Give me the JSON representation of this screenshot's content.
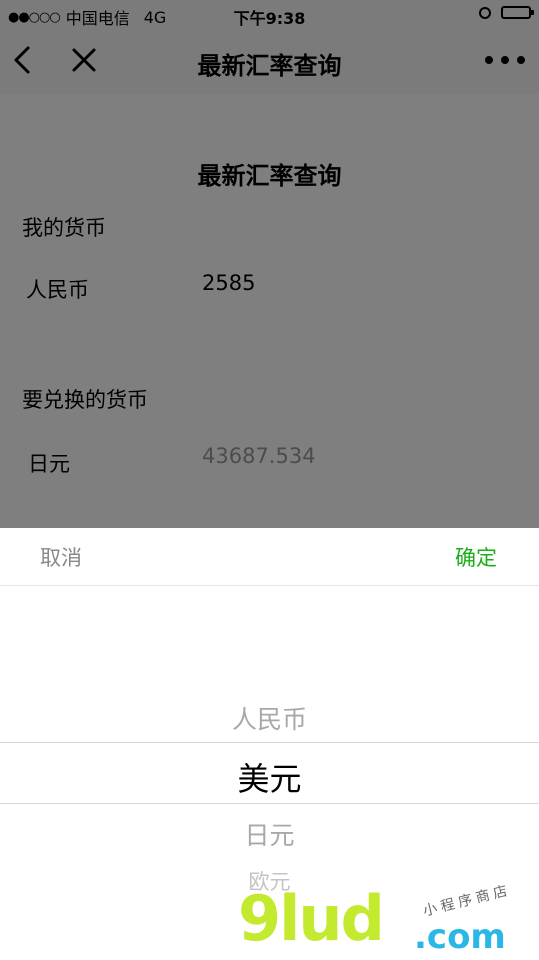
{
  "status_bar": {
    "signal": "●●○○○",
    "carrier": "中国电信",
    "network": "4G",
    "time": "下午9:38"
  },
  "navbar": {
    "title": "最新汇率查询"
  },
  "page": {
    "heading": "最新汇率查询",
    "my_currency_label": "我的货币",
    "my_currency_name": "人民币",
    "my_amount": "2585",
    "target_currency_label": "要兑换的货币",
    "target_currency_name": "日元",
    "converted_amount": "43687.534"
  },
  "picker": {
    "cancel_label": "取消",
    "confirm_label": "确定",
    "options": [
      "人民币",
      "美元",
      "日元",
      "欧元"
    ],
    "selected": "美元"
  },
  "colors": {
    "confirm_green": "#1aad19",
    "overlay": "rgba(0,0,0,0.5)"
  },
  "watermark": {
    "brand": "9lud",
    "domain": ".com",
    "tagline": "小程序商店"
  }
}
